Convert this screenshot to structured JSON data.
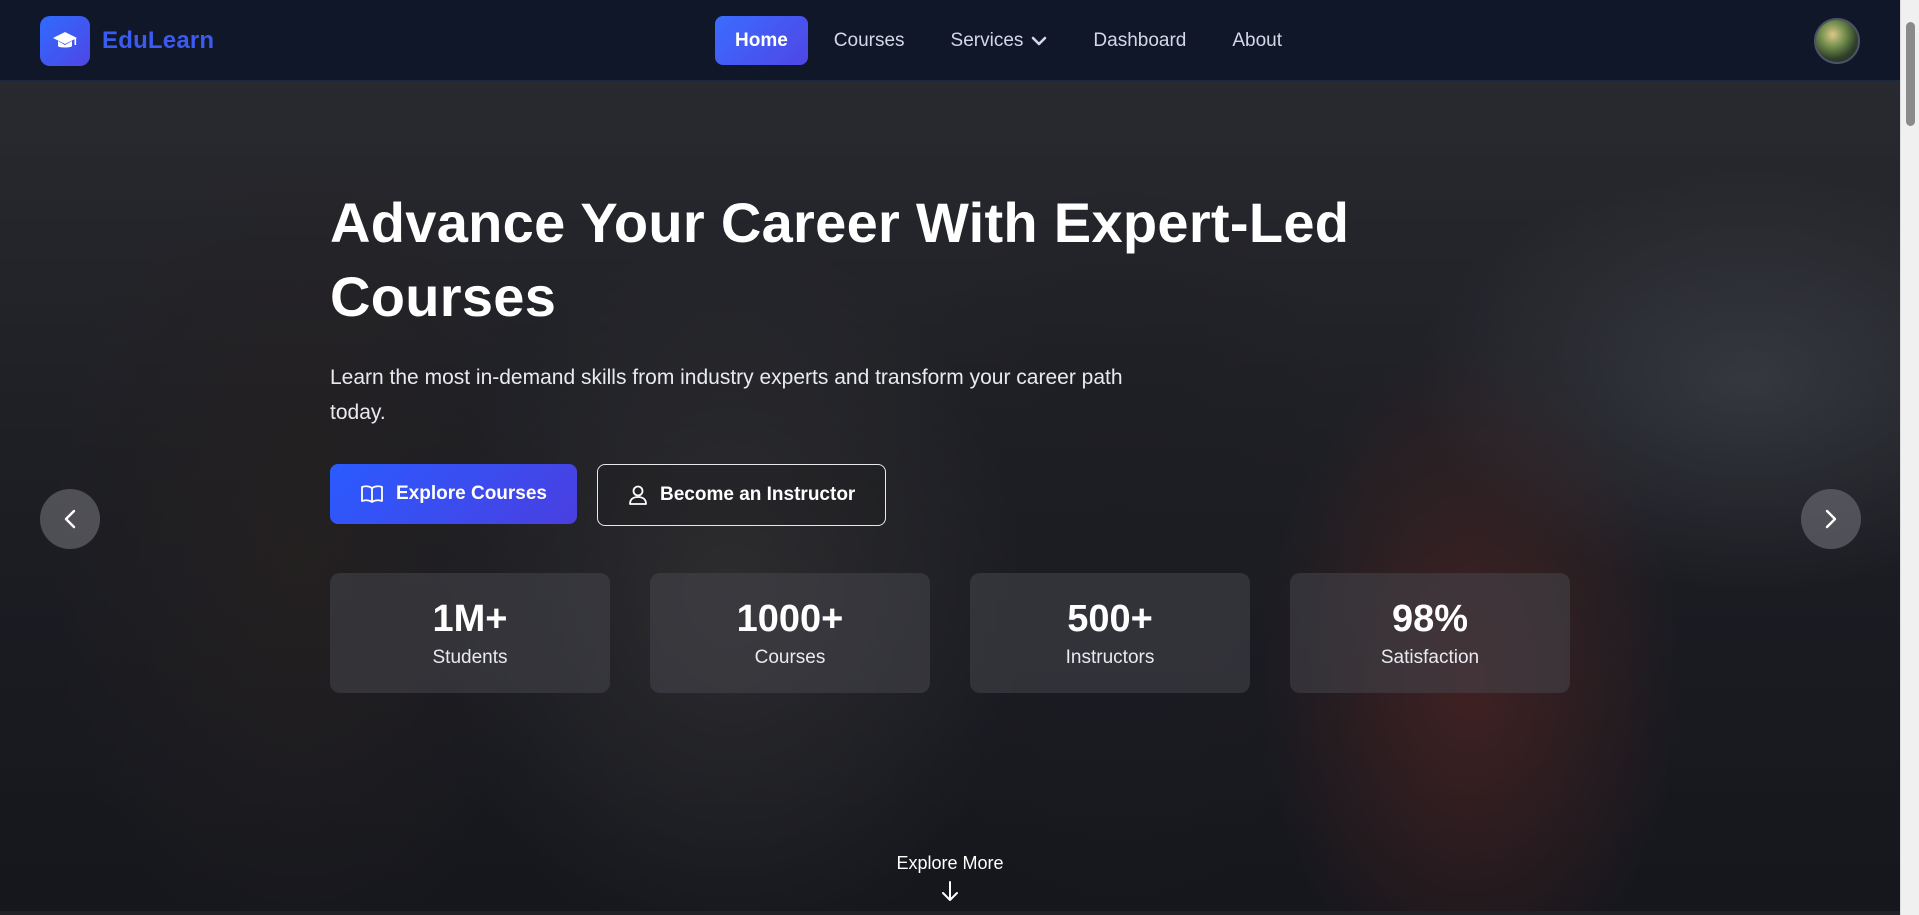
{
  "navbar": {
    "brand": "EduLearn",
    "links": [
      {
        "label": "Home",
        "active": true
      },
      {
        "label": "Courses",
        "active": false
      },
      {
        "label": "Services",
        "active": false,
        "has_dropdown": true
      },
      {
        "label": "Dashboard",
        "active": false
      },
      {
        "label": "About",
        "active": false
      }
    ]
  },
  "hero": {
    "title": "Advance Your Career With Expert-Led Courses",
    "subtitle": "Learn the most in-demand skills from industry experts and transform your career path today.",
    "primary_button": "Explore Courses",
    "secondary_button": "Become an Instructor",
    "stats": [
      {
        "value": "1M+",
        "label": "Students"
      },
      {
        "value": "1000+",
        "label": "Courses"
      },
      {
        "value": "500+",
        "label": "Instructors"
      },
      {
        "value": "98%",
        "label": "Satisfaction"
      }
    ],
    "explore_more": "Explore More"
  },
  "colors": {
    "accent": "#3b6cff",
    "accent_secondary": "#4f46e5",
    "navbar_bg": "#101729",
    "brand_text": "#3b5bf0"
  },
  "icons": {
    "logo": "graduation-cap-icon",
    "dropdown": "chevron-down-icon",
    "primary_button": "book-open-icon",
    "secondary_button": "user-icon",
    "prev": "chevron-left-icon",
    "next": "chevron-right-icon",
    "explore": "arrow-down-icon"
  }
}
